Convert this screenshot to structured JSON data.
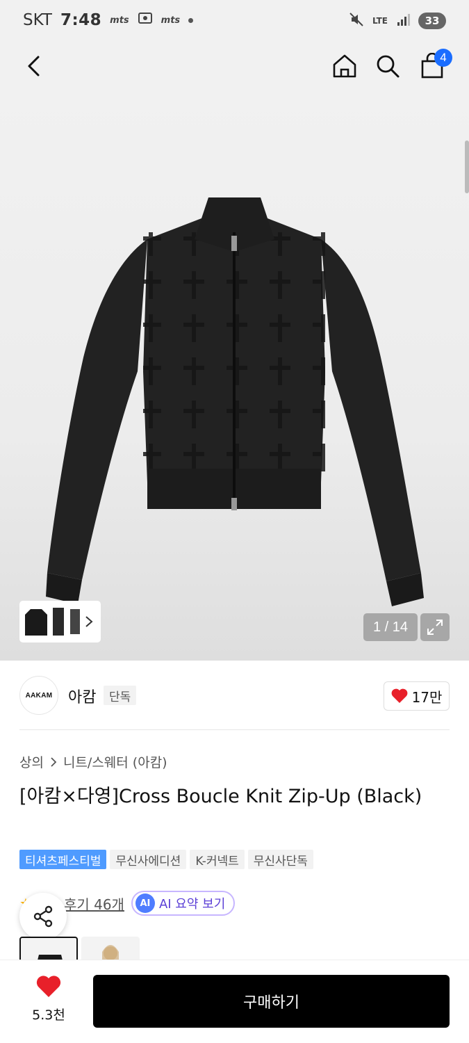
{
  "status_bar": {
    "carrier": "SKT",
    "time": "7:48",
    "app_icons": [
      "mts-icon",
      "screenshot-icon",
      "mts-icon"
    ],
    "network": "LTE",
    "battery": "33"
  },
  "nav": {
    "cart_count": "4"
  },
  "gallery": {
    "counter": "1 / 14"
  },
  "brand": {
    "logo_text": "AAKAM",
    "name": "아캄",
    "exclusive_label": "단독",
    "likes": "17만"
  },
  "breadcrumb": {
    "category": "상의",
    "subcategory": "니트/스웨터 (아캄)"
  },
  "product": {
    "title": "[아캄×다영]Cross Boucle Knit Zip-Up (Black)"
  },
  "tags": [
    {
      "label": "티셔츠페스티벌",
      "highlight": true
    },
    {
      "label": "무신사에디션",
      "highlight": false
    },
    {
      "label": "K-커넥트",
      "highlight": false
    },
    {
      "label": "무신사단독",
      "highlight": false
    }
  ],
  "reviews": {
    "count_label": "후기 46개",
    "ai_icon_text": "AI",
    "ai_label": "AI 요약 보기"
  },
  "bottom": {
    "wish_count": "5.3천",
    "buy_label": "구매하기"
  },
  "colors": {
    "accent_blue": "#1a6dff",
    "tag_blue": "#4f9bff",
    "heart_red": "#e8202a",
    "ai_purple": "#5b3fd6"
  }
}
